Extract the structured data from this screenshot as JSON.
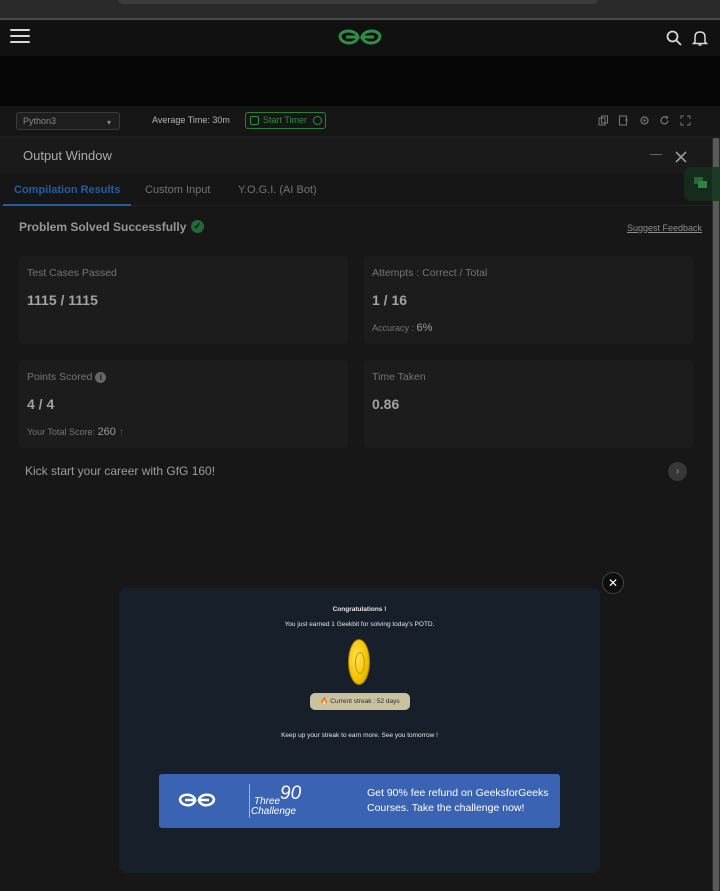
{
  "header": {
    "logo_text": "GfG",
    "search_icon": "search-icon",
    "bell_icon": "bell-icon"
  },
  "toolbar": {
    "language": "Python3",
    "average_time_label": "Average Time: 30m",
    "start_timer_label": "Start Timer",
    "icons": [
      "copy-icon",
      "add-file-icon",
      "settings-icon",
      "refresh-icon",
      "fullscreen-icon"
    ]
  },
  "output_window": {
    "title": "Output Window",
    "tabs": [
      {
        "label": "Compilation Results",
        "active": true
      },
      {
        "label": "Custom Input",
        "active": false
      },
      {
        "label": "Y.O.G.I. (AI Bot)",
        "active": false
      }
    ],
    "status_title": "Problem Solved Successfully",
    "suggest_feedback": "Suggest Feedback",
    "cards": {
      "test_cases": {
        "label": "Test Cases Passed",
        "value": "1115 / 1115"
      },
      "attempts": {
        "label": "Attempts : Correct / Total",
        "value": "1 / 16",
        "accuracy_label": "Accuracy :",
        "accuracy_value": "6%"
      },
      "points": {
        "label": "Points Scored",
        "value": "4 / 4",
        "total_label": "Your Total Score:",
        "total_value": "260"
      },
      "time": {
        "label": "Time Taken",
        "value": "0.86"
      }
    },
    "kick_start": "Kick start your career with GfG 160!"
  },
  "modal": {
    "close_symbol": "✕",
    "congrats": "Congratulations !",
    "earned": "You just earned 1 Geekbit for solving today's POTD.",
    "streak": "Current streak : 52 days",
    "keep_up": "Keep up your streak to earn more. See you tomorrow !",
    "banner": {
      "three": "Three",
      "ninety": "90",
      "challenge": "Challenge",
      "text": "Get 90% fee refund on GeeksforGeeks Courses. Take the challenge now!"
    }
  },
  "colors": {
    "gfg_green": "#2f8d46",
    "accent_blue": "#2e7dd6",
    "banner_blue": "#3a63b3"
  }
}
